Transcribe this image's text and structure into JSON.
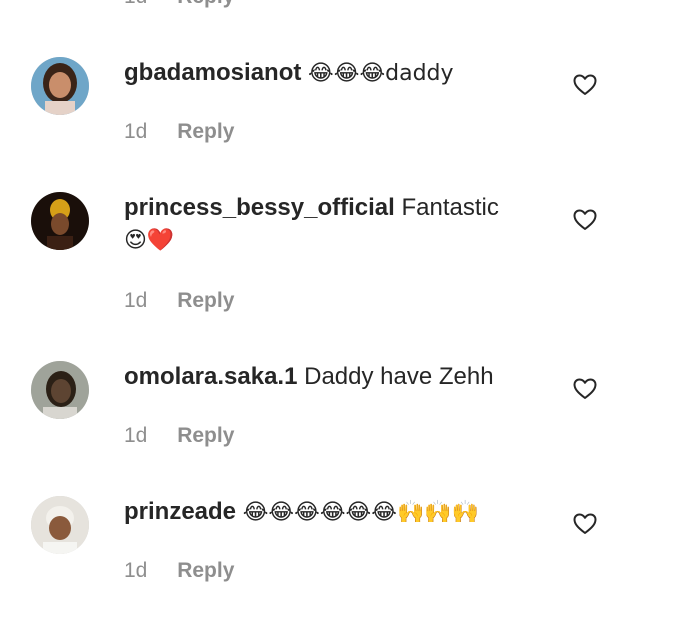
{
  "top_fragment": {
    "time": "1d",
    "reply": "Reply"
  },
  "comments": [
    {
      "username": "gbadamosianot",
      "text": "😂😂😂daddy",
      "time": "1d",
      "reply": "Reply",
      "avatar": "avatar-woman-blue"
    },
    {
      "username": "princess_bessy_official",
      "text": "Fantastic",
      "text2": "😍❤️",
      "time": "1d",
      "reply": "Reply",
      "avatar": "avatar-woman-dark"
    },
    {
      "username": "omolara.saka.1",
      "text": "Daddy have Zehh",
      "time": "1d",
      "reply": "Reply",
      "avatar": "avatar-woman-gray"
    },
    {
      "username": "prinzeade",
      "text": "😂😂😂😂😂😂🙌🙌🙌",
      "time": "1d",
      "reply": "Reply",
      "avatar": "avatar-man-light"
    }
  ]
}
